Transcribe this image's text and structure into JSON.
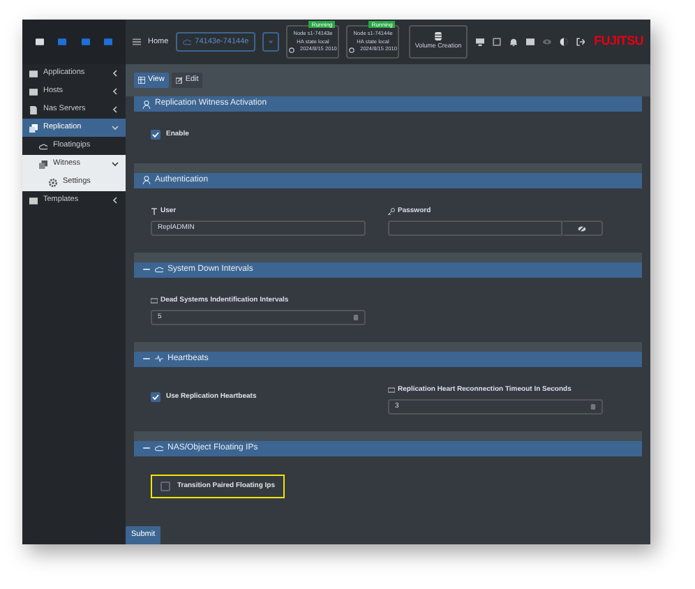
{
  "sidebar": {
    "items": [
      {
        "label": "Applications",
        "expanded": false,
        "selected": false
      },
      {
        "label": "Hosts",
        "expanded": false,
        "selected": false
      },
      {
        "label": "Nas Servers",
        "expanded": false,
        "selected": false
      },
      {
        "label": "Replication",
        "expanded": true,
        "selected": true,
        "children": [
          {
            "label": "Floatingips",
            "selected": false
          },
          {
            "label": "Witness",
            "expanded": true,
            "selected": true,
            "children": [
              {
                "label": "Settings",
                "selected": true
              }
            ]
          }
        ]
      },
      {
        "label": "Templates",
        "expanded": false,
        "selected": false
      }
    ]
  },
  "topbar": {
    "home": "Home",
    "cluster": "74143e-74144e",
    "nodes": [
      {
        "name": "Node s1-74143e",
        "state": "HA state local",
        "time": "2024/8/15 2010",
        "badge": "Running"
      },
      {
        "name": "Node s1-74144e",
        "state": "HA state local",
        "time": "2024/8/15 2010",
        "badge": "Running"
      }
    ],
    "volume_button": "Volume Creation",
    "logo": "FUJITSU"
  },
  "tabs": [
    {
      "label": "View",
      "selected": true
    },
    {
      "label": "Edit",
      "selected": false
    }
  ],
  "sections": [
    {
      "title": "Replication Witness Activation",
      "collapsible": false,
      "fields": [
        {
          "kind": "checkbox",
          "label": "Enable",
          "checked": true
        }
      ]
    },
    {
      "title": "Authentication",
      "collapsible": false,
      "fields": [
        {
          "kind": "text",
          "label": "User",
          "value": "ReplADMIN"
        },
        {
          "kind": "password",
          "label": "Password"
        }
      ]
    },
    {
      "title": "System Down Intervals",
      "collapsible": true,
      "fields": [
        {
          "kind": "number",
          "label": "Dead Systems Indentification Intervals",
          "value": "5"
        }
      ]
    },
    {
      "title": "Heartbeats",
      "collapsible": true,
      "fields": [
        {
          "kind": "checkbox",
          "label": "Use Replication Heartbeats",
          "checked": true
        },
        {
          "kind": "number",
          "label": "Replication Heart Reconnection Timeout In Seconds",
          "value": "3"
        }
      ]
    },
    {
      "title": "NAS/Object Floating IPs",
      "collapsible": true,
      "fields": [
        {
          "kind": "checkbox",
          "label": "Transition Paired Floating Ips",
          "checked": false,
          "highlighted": true
        }
      ]
    }
  ],
  "submit": "Submit"
}
